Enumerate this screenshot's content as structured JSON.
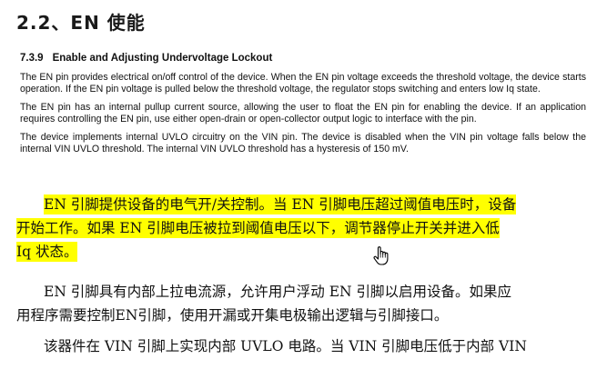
{
  "section_title": "2.2、EN 使能",
  "excerpt": {
    "number": "7.3.9",
    "heading": "Enable and Adjusting Undervoltage Lockout",
    "paragraphs": [
      "The EN pin provides electrical on/off control of the device. When the EN pin voltage exceeds the threshold voltage, the device starts operation. If the EN pin voltage is pulled below the threshold voltage, the regulator stops switching and enters low Iq state.",
      "The EN pin has an internal pullup current source, allowing the user to float the EN pin for enabling the device. If an application requires controlling the EN pin, use either open-drain or open-collector output logic to interface with the pin.",
      "The device implements internal UVLO circuitry on the VIN pin. The device is disabled when the VIN pin voltage falls below the internal VIN UVLO threshold. The internal VIN UVLO threshold has a hysteresis of 150 mV."
    ]
  },
  "translation": {
    "para1_lines": [
      "EN 引脚提供设备的电气开/关控制。当 EN 引脚电压超过阈值电压时，设备",
      "开始工作。如果 EN 引脚电压被拉到阈值电压以下，调节器停止开关并进入低",
      "Iq 状态。"
    ],
    "para2_lines": [
      "EN 引脚具有内部上拉电流源，允许用户浮动 EN 引脚以启用设备。如果应",
      "用程序需要控制EN引脚，使用开漏或开集电极输出逻辑与引脚接口。"
    ],
    "para3_lines": [
      "该器件在 VIN 引脚上实现内部 UVLO 电路。当 VIN 引脚电压低于内部 VIN"
    ]
  },
  "highlight_color": "#ffff00",
  "cursor_icon": "hand-pointer-icon"
}
